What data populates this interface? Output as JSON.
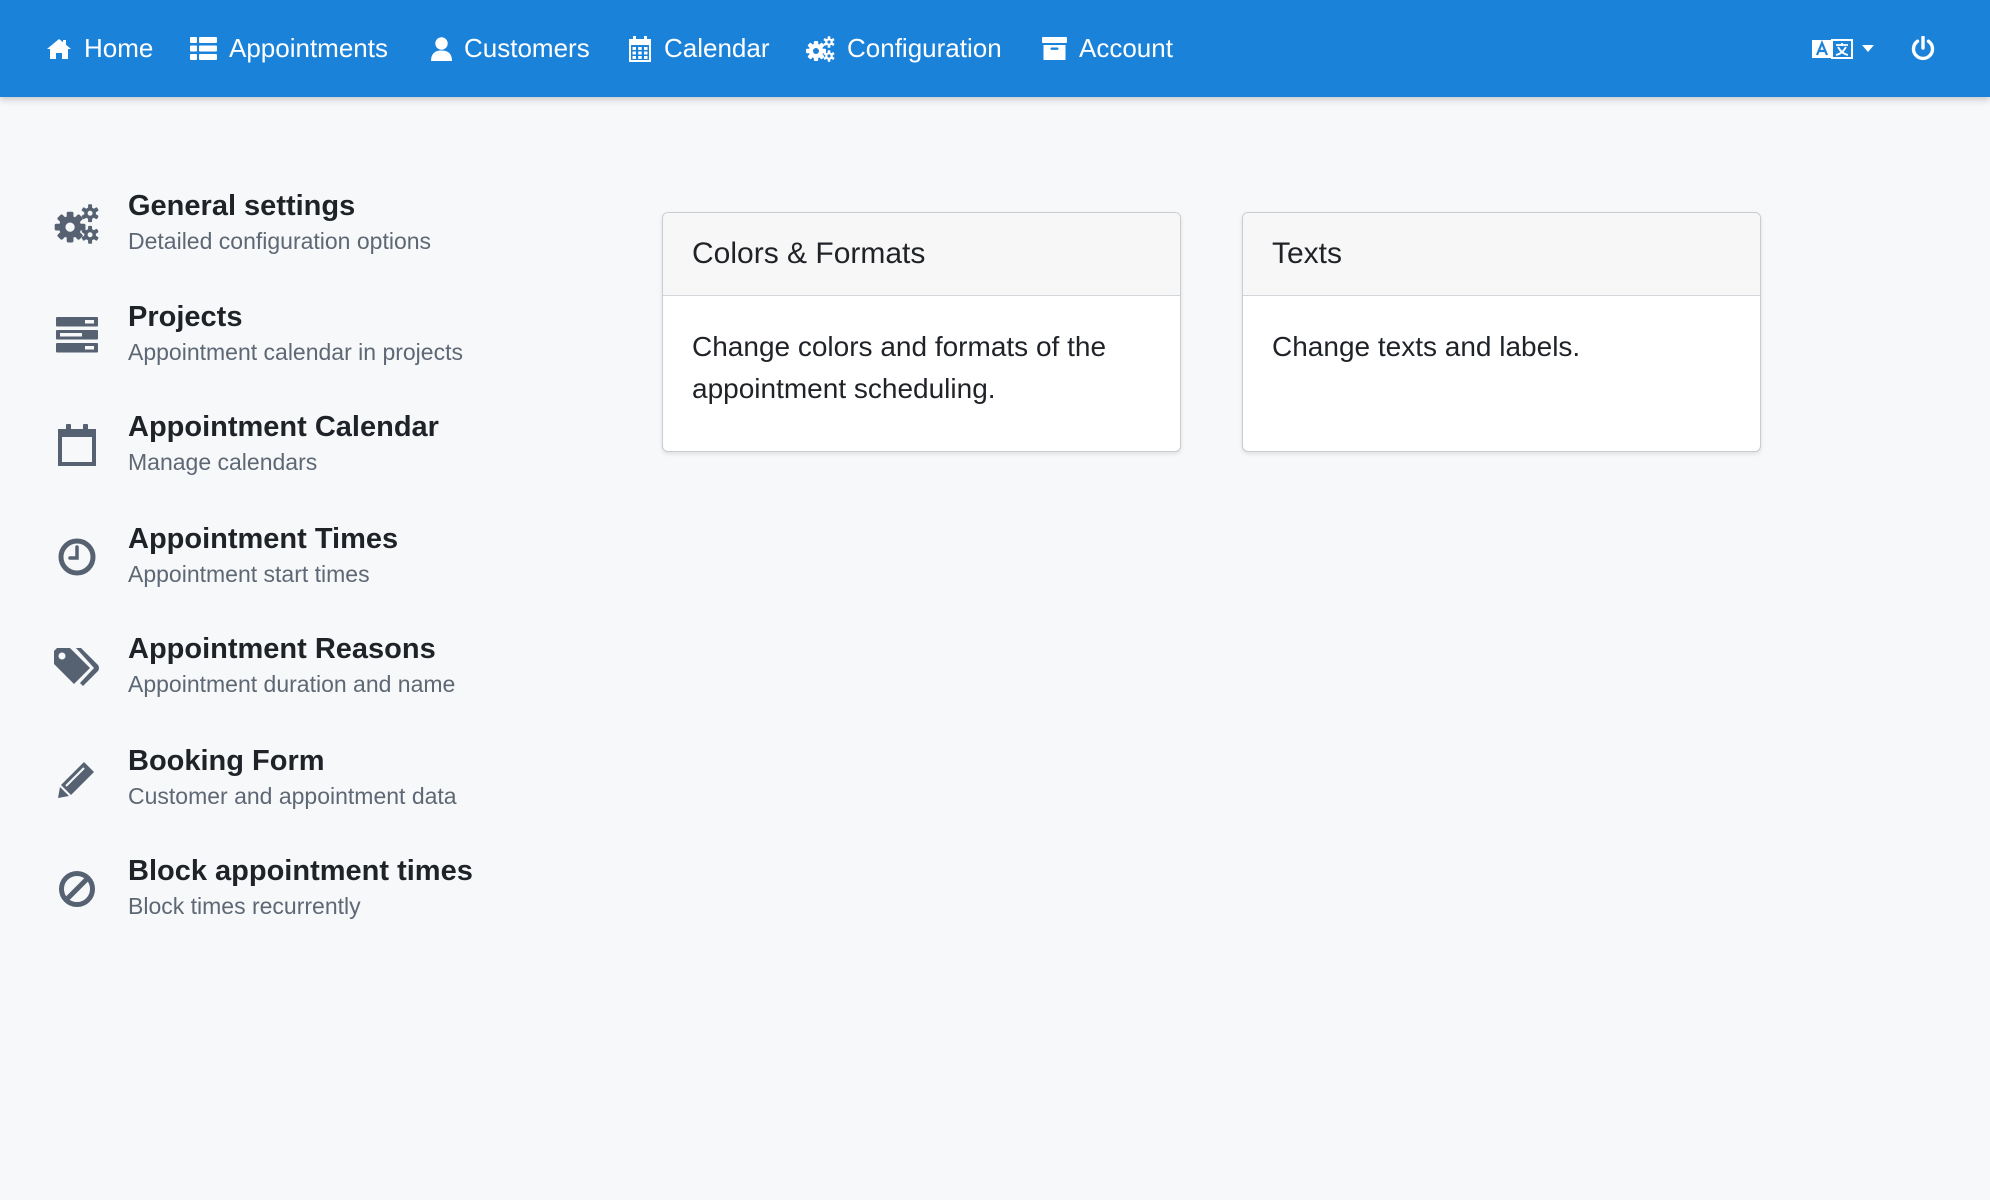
{
  "nav": {
    "items": [
      {
        "label": "Home",
        "icon": "home-icon"
      },
      {
        "label": "Appointments",
        "icon": "list-icon"
      },
      {
        "label": "Customers",
        "icon": "user-icon"
      },
      {
        "label": "Calendar",
        "icon": "calendar-grid-icon"
      },
      {
        "label": "Configuration",
        "icon": "cogs-icon"
      },
      {
        "label": "Account",
        "icon": "archive-icon"
      }
    ],
    "language_icon": "translate-icon",
    "power_icon": "power-icon"
  },
  "sidebar": {
    "items": [
      {
        "title": "General settings",
        "subtitle": "Detailed configuration options",
        "icon": "cogs-icon"
      },
      {
        "title": "Projects",
        "subtitle": "Appointment calendar in projects",
        "icon": "server-icon"
      },
      {
        "title": "Appointment Calendar",
        "subtitle": "Manage calendars",
        "icon": "calendar-icon"
      },
      {
        "title": "Appointment Times",
        "subtitle": "Appointment start times",
        "icon": "clock-icon"
      },
      {
        "title": "Appointment Reasons",
        "subtitle": "Appointment duration and name",
        "icon": "tags-icon"
      },
      {
        "title": "Booking Form",
        "subtitle": "Customer and appointment data",
        "icon": "pencil-icon"
      },
      {
        "title": "Block appointment times",
        "subtitle": "Block times recurrently",
        "icon": "ban-icon"
      }
    ]
  },
  "cards": [
    {
      "title": "Colors & Formats",
      "body": "Change colors and formats of the appointment scheduling."
    },
    {
      "title": "Texts",
      "body": "Change texts and labels."
    }
  ],
  "colors": {
    "navbar": "#1b82da",
    "background": "#f7f8fa",
    "icon_gray": "#566272"
  }
}
